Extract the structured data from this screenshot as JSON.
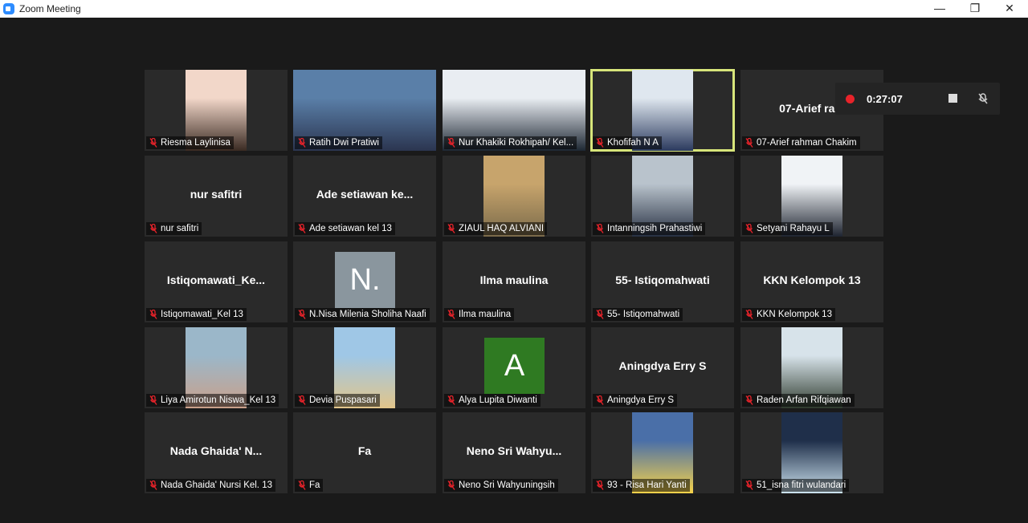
{
  "window": {
    "title": "Zoom Meeting"
  },
  "recording": {
    "time": "0:27:07"
  },
  "colors": {
    "active_speaker": "#d7e57a",
    "mute_icon": "#e8232a",
    "record_dot": "#e8232a"
  },
  "tiles": [
    {
      "label": "Riesma Laylinisa",
      "video": true
    },
    {
      "label": "Ratih Dwi Pratiwi",
      "video": true
    },
    {
      "label": "Nur Khakiki Rokhipah/ Kel...",
      "video": true
    },
    {
      "label": "Khofifah N A",
      "video": true,
      "active": true
    },
    {
      "label": "07-Arief rahman Chakim",
      "display_name": "07-Arief rahı"
    },
    {
      "label": "nur safitri",
      "display_name": "nur safitri"
    },
    {
      "label": "Ade setiawan kel 13",
      "display_name": "Ade setiawan ke..."
    },
    {
      "label": "ZIAUL HAQ ALVIANI",
      "video": true
    },
    {
      "label": "Intanningsih Prahastiwi",
      "video": true
    },
    {
      "label": "Setyani Rahayu L",
      "video": true
    },
    {
      "label": "Istiqomawati_Kel 13",
      "display_name": "Istiqomawati_Ke..."
    },
    {
      "label": "N.Nisa Milenia Sholiha Naafi",
      "avatar_text": "N.",
      "avatar_color": "#8a969e"
    },
    {
      "label": "Ilma maulina",
      "display_name": "Ilma maulina"
    },
    {
      "label": "55- Istiqomahwati",
      "display_name": "55- Istiqomahwati"
    },
    {
      "label": "KKN Kelompok 13",
      "display_name": "KKN Kelompok 13"
    },
    {
      "label": "Liya Amirotun Niswa_Kel 13",
      "video": true
    },
    {
      "label": "Devia Puspasari",
      "video": true
    },
    {
      "label": "Alya Lupita Diwanti",
      "avatar_text": "A",
      "avatar_color": "#2f7a22"
    },
    {
      "label": "Aningdya Erry S",
      "display_name": "Aningdya Erry S"
    },
    {
      "label": "Raden Arfan Rifqiawan",
      "video": true
    },
    {
      "label": "Nada Ghaida' Nursi Kel. 13",
      "display_name": "Nada Ghaida' N..."
    },
    {
      "label": "Fa",
      "display_name": "Fa"
    },
    {
      "label": "Neno Sri Wahyuningsih",
      "display_name": "Neno Sri Wahyu..."
    },
    {
      "label": "93 - Risa Hari Yanti",
      "video": true
    },
    {
      "label": "51_isna fitri wulandari",
      "video": true
    }
  ]
}
